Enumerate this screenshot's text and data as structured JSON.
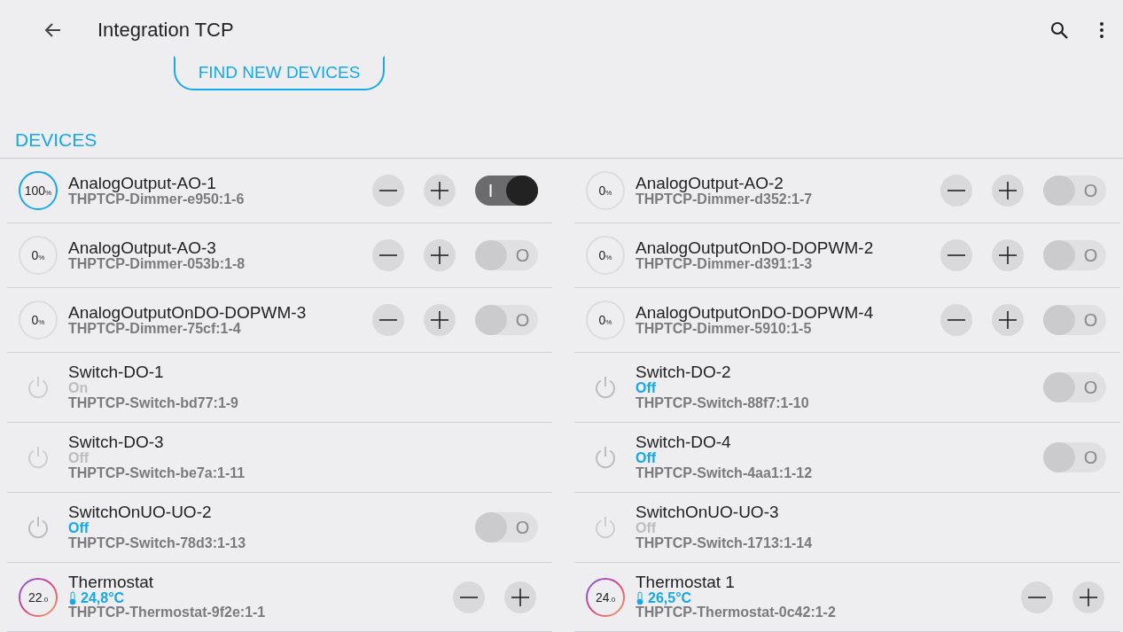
{
  "app_bar": {
    "title": "Integration TCP"
  },
  "find_button": {
    "label": "FIND NEW DEVICES"
  },
  "section": {
    "title": "DEVICES"
  },
  "devices": [
    {
      "kind": "dimmer",
      "name": "AnalogOutput-AO-1",
      "address": "THPTCP-Dimmer-e950:1-6",
      "value": "100",
      "unit": "%",
      "on": true,
      "toggle_label": "I"
    },
    {
      "kind": "dimmer",
      "name": "AnalogOutput-AO-2",
      "address": "THPTCP-Dimmer-d352:1-7",
      "value": "0",
      "unit": "%",
      "on": false,
      "toggle_label": "O"
    },
    {
      "kind": "dimmer",
      "name": "AnalogOutput-AO-3",
      "address": "THPTCP-Dimmer-053b:1-8",
      "value": "0",
      "unit": "%",
      "on": false,
      "toggle_label": "O"
    },
    {
      "kind": "dimmer",
      "name": "AnalogOutputOnDO-DOPWM-2",
      "address": "THPTCP-Dimmer-d391:1-3",
      "value": "0",
      "unit": "%",
      "on": false,
      "toggle_label": "O"
    },
    {
      "kind": "dimmer",
      "name": "AnalogOutputOnDO-DOPWM-3",
      "address": "THPTCP-Dimmer-75cf:1-4",
      "value": "0",
      "unit": "%",
      "on": false,
      "toggle_label": "O"
    },
    {
      "kind": "dimmer",
      "name": "AnalogOutputOnDO-DOPWM-4",
      "address": "THPTCP-Dimmer-5910:1-5",
      "value": "0",
      "unit": "%",
      "on": false,
      "toggle_label": "O"
    },
    {
      "kind": "switch",
      "name": "Switch-DO-1",
      "status": "On",
      "address": "THPTCP-Switch-bd77:1-9",
      "available": false
    },
    {
      "kind": "switch",
      "name": "Switch-DO-2",
      "status": "Off",
      "address": "THPTCP-Switch-88f7:1-10",
      "available": true,
      "on": false,
      "toggle_label": "O"
    },
    {
      "kind": "switch",
      "name": "Switch-DO-3",
      "status": "Off",
      "address": "THPTCP-Switch-be7a:1-11",
      "available": false
    },
    {
      "kind": "switch",
      "name": "Switch-DO-4",
      "status": "Off",
      "address": "THPTCP-Switch-4aa1:1-12",
      "available": true,
      "on": false,
      "toggle_label": "O"
    },
    {
      "kind": "switch",
      "name": "SwitchOnUO-UO-2",
      "status": "Off",
      "address": "THPTCP-Switch-78d3:1-13",
      "available": true,
      "on": false,
      "toggle_label": "O"
    },
    {
      "kind": "switch",
      "name": "SwitchOnUO-UO-3",
      "status": "Off",
      "address": "THPTCP-Switch-1713:1-14",
      "available": false
    },
    {
      "kind": "thermostat",
      "name": "Thermostat",
      "setpoint": "22",
      "decimal": ".0",
      "temperature": "24,8°C",
      "address": "THPTCP-Thermostat-9f2e:1-1"
    },
    {
      "kind": "thermostat",
      "name": "Thermostat 1",
      "setpoint": "24",
      "decimal": ".0",
      "temperature": "26,5°C",
      "address": "THPTCP-Thermostat-0c42:1-2"
    }
  ]
}
